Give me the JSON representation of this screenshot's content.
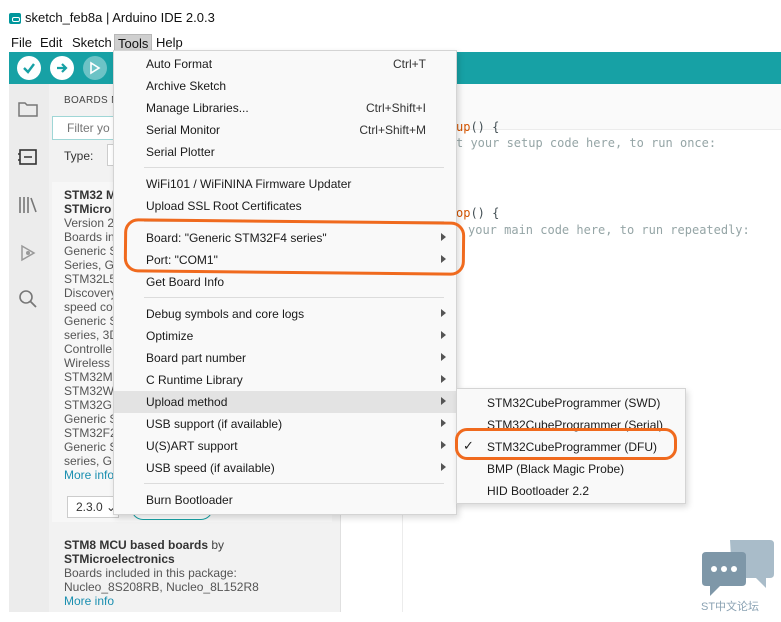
{
  "window": {
    "title": "sketch_feb8a | Arduino IDE 2.0.3"
  },
  "menubar": {
    "items": [
      "File",
      "Edit",
      "Sketch",
      "Tools",
      "Help"
    ]
  },
  "boards_panel": {
    "title": "BOARDS M",
    "filter_placeholder": "Filter yo",
    "type_label": "Type:",
    "card1": {
      "title": "STM32 M",
      "maker": "STMicro",
      "version": "Version 2",
      "lines": [
        "Boards in",
        "Generic S",
        "Series, G",
        "STM32L5",
        "Discovery",
        "speed co",
        "Generic S",
        "series, 3D",
        "Controlle",
        "Wireless",
        "STM32M",
        "STM32W",
        "STM32G",
        "Generic S",
        "STM32F2",
        "Generic S",
        "series, G"
      ],
      "more_info": "More info",
      "version_select": "2.3.0"
    },
    "card2": {
      "title": "STM8 MCU based boards",
      "by": "by",
      "maker": "STMicroelectronics",
      "included": "Boards included in this package:",
      "boards": "Nucleo_8S208RB, Nucleo_8L152R8",
      "more_info": "More info"
    }
  },
  "editor": {
    "line1_kw": "up",
    "line1_rest": "() {",
    "line2": "t your setup code here, to run once:",
    "line3_kw": "op",
    "line3_rest": "() {",
    "line4": "your main code here, to run repeatedly:"
  },
  "tools_menu": {
    "items": [
      {
        "label": "Auto Format",
        "shortcut": "Ctrl+T"
      },
      {
        "label": "Archive Sketch",
        "shortcut": ""
      },
      {
        "label": "Manage Libraries...",
        "shortcut": "Ctrl+Shift+I"
      },
      {
        "label": "Serial Monitor",
        "shortcut": "Ctrl+Shift+M"
      },
      {
        "label": "Serial Plotter",
        "shortcut": ""
      },
      {
        "label": "WiFi101 / WiFiNINA Firmware Updater",
        "shortcut": ""
      },
      {
        "label": "Upload SSL Root Certificates",
        "shortcut": ""
      },
      {
        "label": "Board: \"Generic STM32F4 series\"",
        "shortcut": ""
      },
      {
        "label": "Port: \"COM1\"",
        "shortcut": ""
      },
      {
        "label": "Get Board Info",
        "shortcut": ""
      },
      {
        "label": "Debug symbols and core logs",
        "shortcut": ""
      },
      {
        "label": "Optimize",
        "shortcut": ""
      },
      {
        "label": "Board part number",
        "shortcut": ""
      },
      {
        "label": "C Runtime Library",
        "shortcut": ""
      },
      {
        "label": "Upload method",
        "shortcut": ""
      },
      {
        "label": "USB support (if available)",
        "shortcut": ""
      },
      {
        "label": "U(S)ART support",
        "shortcut": ""
      },
      {
        "label": "USB speed (if available)",
        "shortcut": ""
      },
      {
        "label": "Burn Bootloader",
        "shortcut": ""
      }
    ]
  },
  "upload_submenu": {
    "items": [
      {
        "label": "STM32CubeProgrammer (SWD)",
        "checked": false
      },
      {
        "label": "STM32CubeProgrammer (Serial)",
        "checked": false
      },
      {
        "label": "STM32CubeProgrammer (DFU)",
        "checked": true
      },
      {
        "label": "BMP (Black Magic Probe)",
        "checked": false
      },
      {
        "label": "HID Bootloader 2.2",
        "checked": false
      }
    ],
    "check_glyph": "✓"
  },
  "watermark": {
    "text": "ST中文论坛"
  },
  "colors": {
    "accent": "#17a1a5",
    "annotation": "#f06a1e",
    "link": "#1a8fb0"
  }
}
